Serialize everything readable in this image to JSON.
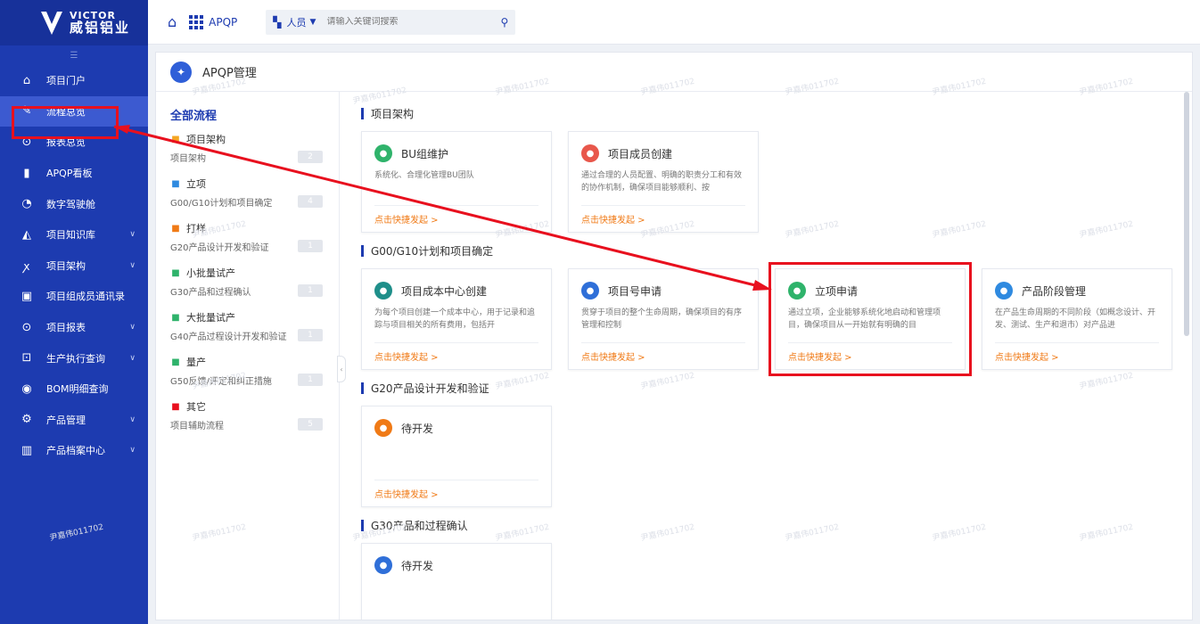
{
  "brand": {
    "en": "VICTOR",
    "cn": "威铝铝业"
  },
  "sidebar": {
    "items": [
      {
        "label": "项目门户",
        "icon": "home-outline-icon",
        "glyph": "⌂",
        "chevron": false
      },
      {
        "label": "流程总览",
        "icon": "edit-square-icon",
        "glyph": "✎",
        "chevron": false,
        "active": true
      },
      {
        "label": "报表总览",
        "icon": "search-report-icon",
        "glyph": "⊙",
        "chevron": false
      },
      {
        "label": "APQP看板",
        "icon": "bar-chart-icon",
        "glyph": "▮",
        "chevron": false
      },
      {
        "label": "数字驾驶舱",
        "icon": "dashboard-icon",
        "glyph": "◔",
        "chevron": false
      },
      {
        "label": "项目知识库",
        "icon": "knowledge-icon",
        "glyph": "◭",
        "chevron": true
      },
      {
        "label": "项目架构",
        "icon": "users-icon",
        "glyph": "ꭗ",
        "chevron": true
      },
      {
        "label": "项目组成员通讯录",
        "icon": "contacts-icon",
        "glyph": "▣",
        "chevron": false
      },
      {
        "label": "项目报表",
        "icon": "report-icon",
        "glyph": "⊙",
        "chevron": true
      },
      {
        "label": "生产执行查询",
        "icon": "production-icon",
        "glyph": "⊡",
        "chevron": true
      },
      {
        "label": "BOM明细查询",
        "icon": "bom-icon",
        "glyph": "◉",
        "chevron": false
      },
      {
        "label": "产品管理",
        "icon": "gear-icon",
        "glyph": "⚙",
        "chevron": true
      },
      {
        "label": "产品档案中心",
        "icon": "archive-icon",
        "glyph": "▥",
        "chevron": true
      }
    ]
  },
  "topbar": {
    "app_name": "APQP",
    "search": {
      "scope": "人员",
      "placeholder": "请输入关键词搜索"
    }
  },
  "main": {
    "title": "APQP管理",
    "left": {
      "all_label": "全部流程",
      "categories": [
        {
          "name": "项目架构",
          "sub": "项目架构",
          "count": "2",
          "icon": "org-icon",
          "color": "#f5a623"
        },
        {
          "name": "立项",
          "sub": "G00/G10计划和项目确定",
          "count": "4",
          "icon": "project-icon",
          "color": "#2f8ae0"
        },
        {
          "name": "打样",
          "sub": "G20产品设计开发和验证",
          "count": "1",
          "icon": "sample-icon",
          "color": "#f07a16"
        },
        {
          "name": "小批量试产",
          "sub": "G30产品和过程确认",
          "count": "1",
          "icon": "trial-icon",
          "color": "#2fb36b"
        },
        {
          "name": "大批量试产",
          "sub": "G40产品过程设计开发和验证",
          "count": "1",
          "icon": "mass-trial-icon",
          "color": "#2fb36b"
        },
        {
          "name": "量产",
          "sub": "G50反馈/评定和纠正措施",
          "count": "1",
          "icon": "production-check-icon",
          "color": "#2fb36b"
        },
        {
          "name": "其它",
          "sub": "项目辅助流程",
          "count": "5",
          "icon": "more-icon",
          "color": "#e8101e"
        }
      ]
    },
    "sections": [
      {
        "title": "项目架构",
        "cards": [
          {
            "title": "BU组维护",
            "desc": "系统化、合理化管理BU团队",
            "link": "点击快捷发起 >",
            "icon": "landscape-icon",
            "color": "#2fb36b"
          },
          {
            "title": "项目成员创建",
            "desc": "通过合理的人员配置、明确的职责分工和有效的协作机制，确保项目能够顺利、按",
            "link": "点击快捷发起 >",
            "icon": "team-icon",
            "color": "#e8574b"
          }
        ]
      },
      {
        "title": "G00/G10计划和项目确定",
        "cards": [
          {
            "title": "项目成本中心创建",
            "desc": "为每个项目创建一个成本中心，用于记录和追踪与项目相关的所有费用，包括开",
            "link": "点击快捷发起 >",
            "icon": "database-icon",
            "color": "#1f8f8a"
          },
          {
            "title": "项目号申请",
            "desc": "贯穿于项目的整个生命周期，确保项目的有序管理和控制",
            "link": "点击快捷发起 >",
            "icon": "link-icon",
            "color": "#2f6fd8"
          },
          {
            "title": "立项申请",
            "desc": "通过立项，企业能够系统化地启动和管理项目，确保项目从一开始就有明确的目",
            "link": "点击快捷发起 >",
            "icon": "approval-icon",
            "color": "#2fb36b",
            "highlight": true
          },
          {
            "title": "产品阶段管理",
            "desc": "在产品生命周期的不同阶段（如概念设计、开发、测试、生产和退市）对产品进",
            "link": "点击快捷发起 >",
            "icon": "stage-icon",
            "color": "#2f8ae0"
          }
        ]
      },
      {
        "title": "G20产品设计开发和验证",
        "cards": [
          {
            "title": "待开发",
            "desc": "",
            "link": "点击快捷发起 >",
            "icon": "bookmark-plus-icon",
            "color": "#f07a16"
          }
        ]
      },
      {
        "title": "G30产品和过程确认",
        "cards": [
          {
            "title": "待开发",
            "desc": "",
            "link": "",
            "icon": "trend-icon",
            "color": "#2f6fd8"
          }
        ]
      }
    ]
  },
  "watermark": "尹嘉伟011702",
  "colors": {
    "sidebar": "#1d3bb0",
    "accent": "#1d3bb0",
    "link": "#f07a16",
    "annotation": "#e8101e"
  }
}
